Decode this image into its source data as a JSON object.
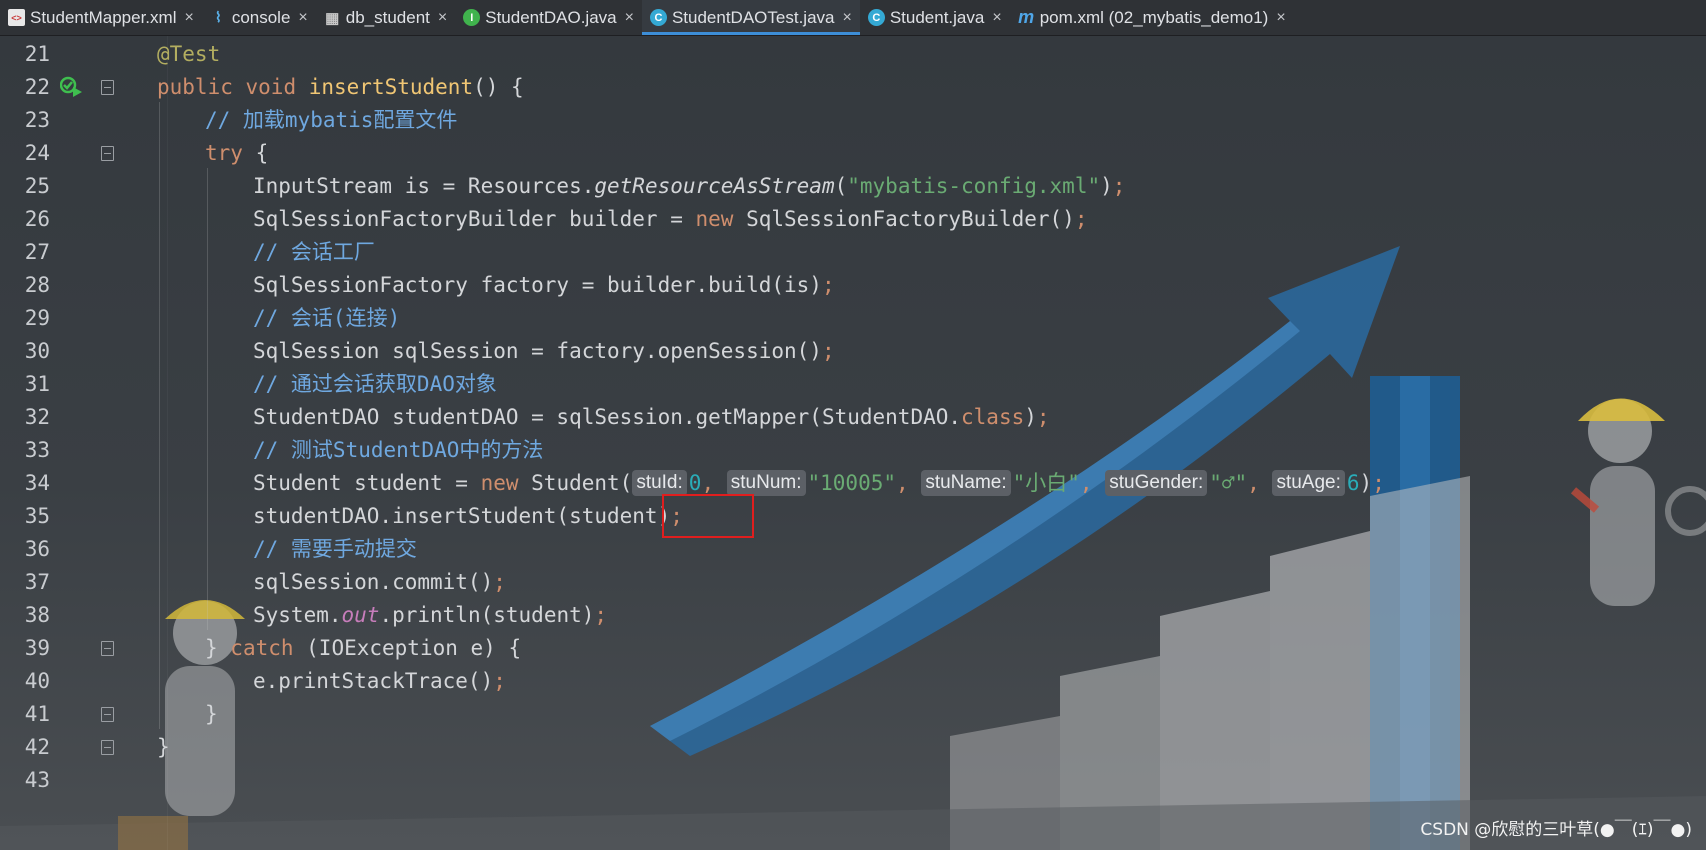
{
  "tabs": [
    {
      "label": "StudentMapper.xml",
      "icon": "xml-file-icon"
    },
    {
      "label": "console",
      "icon": "console-icon"
    },
    {
      "label": "db_student",
      "icon": "table-icon"
    },
    {
      "label": "StudentDAO.java",
      "icon": "interface-icon"
    },
    {
      "label": "StudentDAOTest.java",
      "icon": "class-icon",
      "active": true
    },
    {
      "label": "Student.java",
      "icon": "class-icon"
    },
    {
      "label": "pom.xml (02_mybatis_demo1)",
      "icon": "maven-icon"
    }
  ],
  "lines": [
    {
      "n": "21",
      "t": [
        [
          "ann",
          "@Test"
        ]
      ]
    },
    {
      "n": "22",
      "t": [
        [
          "kw",
          "public "
        ],
        [
          "kw",
          "void "
        ],
        [
          "fn",
          "insertStudent"
        ],
        [
          "",
          "() {"
        ]
      ]
    },
    {
      "n": "23",
      "t": [
        [
          "cm",
          "// 加载mybatis配置文件"
        ]
      ]
    },
    {
      "n": "24",
      "t": [
        [
          "kw",
          "try "
        ],
        [
          "",
          "{"
        ]
      ]
    },
    {
      "n": "25",
      "t": [
        [
          "",
          "InputStream is = Resources."
        ],
        [
          "it",
          "getResourceAsStream"
        ],
        [
          "",
          "("
        ],
        [
          "str",
          "\"mybatis-config.xml\""
        ],
        [
          "",
          ")"
        ],
        [
          "kw",
          ";"
        ]
      ]
    },
    {
      "n": "26",
      "t": [
        [
          "",
          "SqlSessionFactoryBuilder builder = "
        ],
        [
          "kw",
          "new "
        ],
        [
          "",
          "SqlSessionFactoryBuilder()"
        ],
        [
          "kw",
          ";"
        ]
      ]
    },
    {
      "n": "27",
      "t": [
        [
          "cm",
          "// 会话工厂"
        ]
      ]
    },
    {
      "n": "28",
      "t": [
        [
          "",
          "SqlSessionFactory factory = builder.build(is)"
        ],
        [
          "kw",
          ";"
        ]
      ]
    },
    {
      "n": "29",
      "t": [
        [
          "cm",
          "// 会话(连接)"
        ]
      ]
    },
    {
      "n": "30",
      "t": [
        [
          "",
          "SqlSession sqlSession = factory.openSession()"
        ],
        [
          "kw",
          ";"
        ]
      ]
    },
    {
      "n": "31",
      "t": [
        [
          "cm",
          "// 通过会话获取DAO对象"
        ]
      ]
    },
    {
      "n": "32",
      "t": [
        [
          "",
          "StudentDAO studentDAO = sqlSession.getMapper(StudentDAO."
        ],
        [
          "kw",
          "class"
        ],
        [
          "",
          ")"
        ],
        [
          "kw",
          ";"
        ]
      ]
    },
    {
      "n": "33",
      "t": [
        [
          "cm",
          "// 测试StudentDAO中的方法"
        ]
      ]
    },
    {
      "n": "34",
      "t": [
        [
          "",
          "Student student = "
        ],
        [
          "kw",
          "new "
        ],
        [
          "",
          "Student("
        ],
        [
          "hint",
          "stuId:"
        ],
        [
          "num",
          "0"
        ],
        [
          "kw",
          ", "
        ],
        [
          "hint",
          "stuNum:"
        ],
        [
          "str",
          "\"10005\""
        ],
        [
          "kw",
          ", "
        ],
        [
          "hint",
          "stuName:"
        ],
        [
          "str",
          "\"小白\""
        ],
        [
          "kw",
          ", "
        ],
        [
          "hint",
          "stuGender:"
        ],
        [
          "str",
          "\"♂\""
        ],
        [
          "kw",
          ", "
        ],
        [
          "hint",
          "stuAge:"
        ],
        [
          "num",
          "6"
        ],
        [
          "",
          ")"
        ],
        [
          "kw",
          ";"
        ]
      ]
    },
    {
      "n": "35",
      "t": [
        [
          "",
          "studentDAO.insertStudent(student)"
        ],
        [
          "kw",
          ";"
        ]
      ]
    },
    {
      "n": "36",
      "t": [
        [
          "cm",
          "// 需要手动提交"
        ]
      ]
    },
    {
      "n": "37",
      "t": [
        [
          "",
          "sqlSession.commit()"
        ],
        [
          "kw",
          ";"
        ]
      ]
    },
    {
      "n": "38",
      "t": [
        [
          "",
          "System."
        ],
        [
          "fld",
          "out"
        ],
        [
          "",
          ".println(student)"
        ],
        [
          "kw",
          ";"
        ]
      ]
    },
    {
      "n": "39",
      "t": [
        [
          "",
          "} "
        ],
        [
          "kw",
          "catch "
        ],
        [
          "",
          "(IOException e) {"
        ]
      ]
    },
    {
      "n": "40",
      "t": [
        [
          "",
          "e.printStackTrace()"
        ],
        [
          "kw",
          ";"
        ]
      ]
    },
    {
      "n": "41",
      "t": [
        [
          "",
          "}"
        ]
      ]
    },
    {
      "n": "42",
      "t": [
        [
          "",
          "}"
        ]
      ]
    },
    {
      "n": "43",
      "t": []
    }
  ],
  "watermark": "CSDN @欣慰的三叶草(●￣(ｴ)￣●)"
}
